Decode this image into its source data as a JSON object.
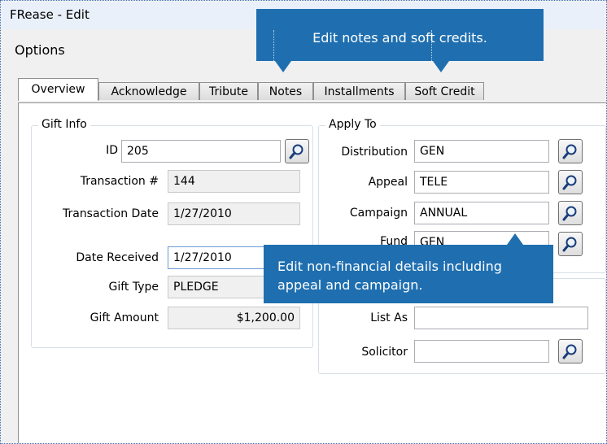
{
  "window": {
    "title": "FRease - Edit"
  },
  "menu": {
    "options": "Options"
  },
  "tabs": [
    "Overview",
    "Acknowledge",
    "Tribute",
    "Notes",
    "Installments",
    "Soft Credit"
  ],
  "gift_info": {
    "title": "Gift Info",
    "id_label": "ID",
    "id_value": "205",
    "transaction_label": "Transaction #",
    "transaction_value": "144",
    "transaction_date_label": "Transaction Date",
    "transaction_date_value": "1/27/2010",
    "date_received_label": "Date Received",
    "date_received_value": "1/27/2010",
    "gift_type_label": "Gift Type",
    "gift_type_value": "PLEDGE",
    "gift_amount_label": "Gift Amount",
    "gift_amount_value": "$1,200.00"
  },
  "apply_to": {
    "title": "Apply To",
    "distribution_label": "Distribution",
    "distribution_value": "GEN",
    "appeal_label": "Appeal",
    "appeal_value": "TELE",
    "campaign_label": "Campaign",
    "campaign_value": "ANNUAL",
    "fund_label": "Fund",
    "fund_value": "GEN"
  },
  "other": {
    "list_as_label": "List As",
    "list_as_value": "",
    "solicitor_label": "Solicitor",
    "solicitor_value": ""
  },
  "callouts": {
    "top": "Edit notes and soft credits.",
    "bottom": "Edit non-financial details including appeal and campaign."
  },
  "colors": {
    "callout": "#1f6fb0",
    "title_bar": "#e9f0fa"
  },
  "icons": {
    "lookup": "magnifier-icon"
  }
}
